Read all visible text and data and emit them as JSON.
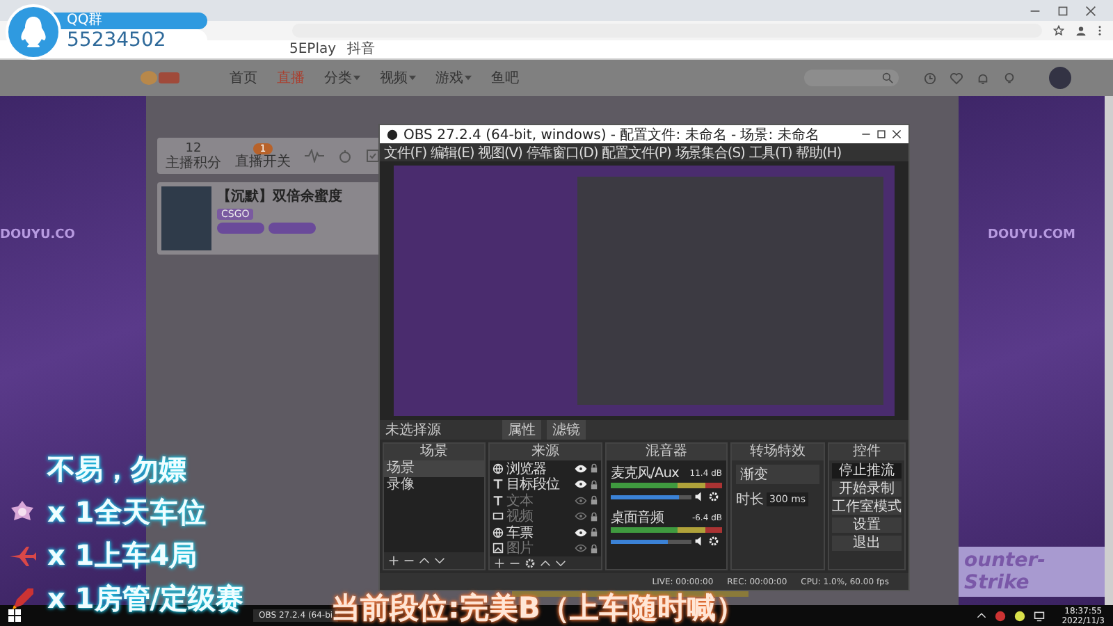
{
  "qq_badge": {
    "label": "QQ群",
    "number": "55234502"
  },
  "browser": {
    "bookmarks": [
      "5EPlay",
      "抖音"
    ]
  },
  "site": {
    "nav": [
      {
        "label": "首页",
        "selected": false,
        "dropdown": false
      },
      {
        "label": "直播",
        "selected": true,
        "dropdown": false
      },
      {
        "label": "分类",
        "selected": false,
        "dropdown": true
      },
      {
        "label": "视频",
        "selected": false,
        "dropdown": true
      },
      {
        "label": "游戏",
        "selected": false,
        "dropdown": true
      },
      {
        "label": "鱼吧",
        "selected": false,
        "dropdown": false
      }
    ],
    "side_text": [
      "DOUYU.CO",
      "DOUYU.COM"
    ],
    "stats": [
      {
        "value": "12",
        "label": "主播积分"
      },
      {
        "value": "1",
        "label": "直播开关"
      }
    ],
    "room": {
      "title": "【沉默】双倍余蜜度",
      "category": "CSGO"
    },
    "banner": "ounter-Strike"
  },
  "obs": {
    "title": "OBS 27.2.4 (64-bit, windows) - 配置文件: 未命名 - 场景: 未命名",
    "menu": [
      "文件(F)",
      "编辑(E)",
      "视图(V)",
      "停靠窗口(D)",
      "配置文件(P)",
      "场景集合(S)",
      "工具(T)",
      "帮助(H)"
    ],
    "source_status": "未选择源",
    "source_buttons": [
      "属性",
      "滤镜"
    ],
    "scenes": {
      "title": "场景",
      "items": [
        {
          "label": "场景",
          "selected": true
        },
        {
          "label": "录像",
          "selected": false
        }
      ]
    },
    "sources": {
      "title": "来源",
      "items": [
        {
          "label": "浏览器",
          "kind": "browser",
          "visible": true
        },
        {
          "label": "目标段位",
          "kind": "text",
          "visible": true
        },
        {
          "label": "文本",
          "kind": "text",
          "visible": false
        },
        {
          "label": "视频",
          "kind": "video",
          "visible": false
        },
        {
          "label": "车票",
          "kind": "browser",
          "visible": true
        },
        {
          "label": "图片",
          "kind": "image",
          "visible": false
        }
      ]
    },
    "mixer": {
      "title": "混音器",
      "channels": [
        {
          "name": "麦克风/Aux",
          "reading": "11.4 dB",
          "level": 0.85
        },
        {
          "name": "桌面音频",
          "reading": "-6.4 dB",
          "level": 0.7
        }
      ]
    },
    "transitions": {
      "title": "转场特效",
      "type": "渐变",
      "duration_label": "时长",
      "duration": "300 ms"
    },
    "controls": {
      "title": "控件",
      "buttons": [
        {
          "label": "停止推流",
          "active": true
        },
        {
          "label": "开始录制",
          "active": false
        },
        {
          "label": "工作室模式",
          "active": false
        },
        {
          "label": "设置",
          "active": false
        },
        {
          "label": "退出",
          "active": false
        }
      ]
    },
    "status": {
      "live": "LIVE: 00:00:00",
      "rec": "REC: 00:00:00",
      "cpu": "CPU: 1.0%, 60.00 fps"
    }
  },
  "overlay": {
    "lines": [
      {
        "kind": "heading",
        "text": "不易，勿嫖"
      },
      {
        "kind": "medal",
        "text": "x 1全天车位"
      },
      {
        "kind": "plane",
        "text": "x 1上车4局"
      },
      {
        "kind": "rocket",
        "text": "x 1房管/定级赛"
      }
    ],
    "rank": "当前段位:完美B（上车随时喊）"
  },
  "taskbar": {
    "tasks": [
      "OBS 27.2.4 (64-bi"
    ],
    "time": "18:37:55",
    "date": "2022/11/3"
  }
}
